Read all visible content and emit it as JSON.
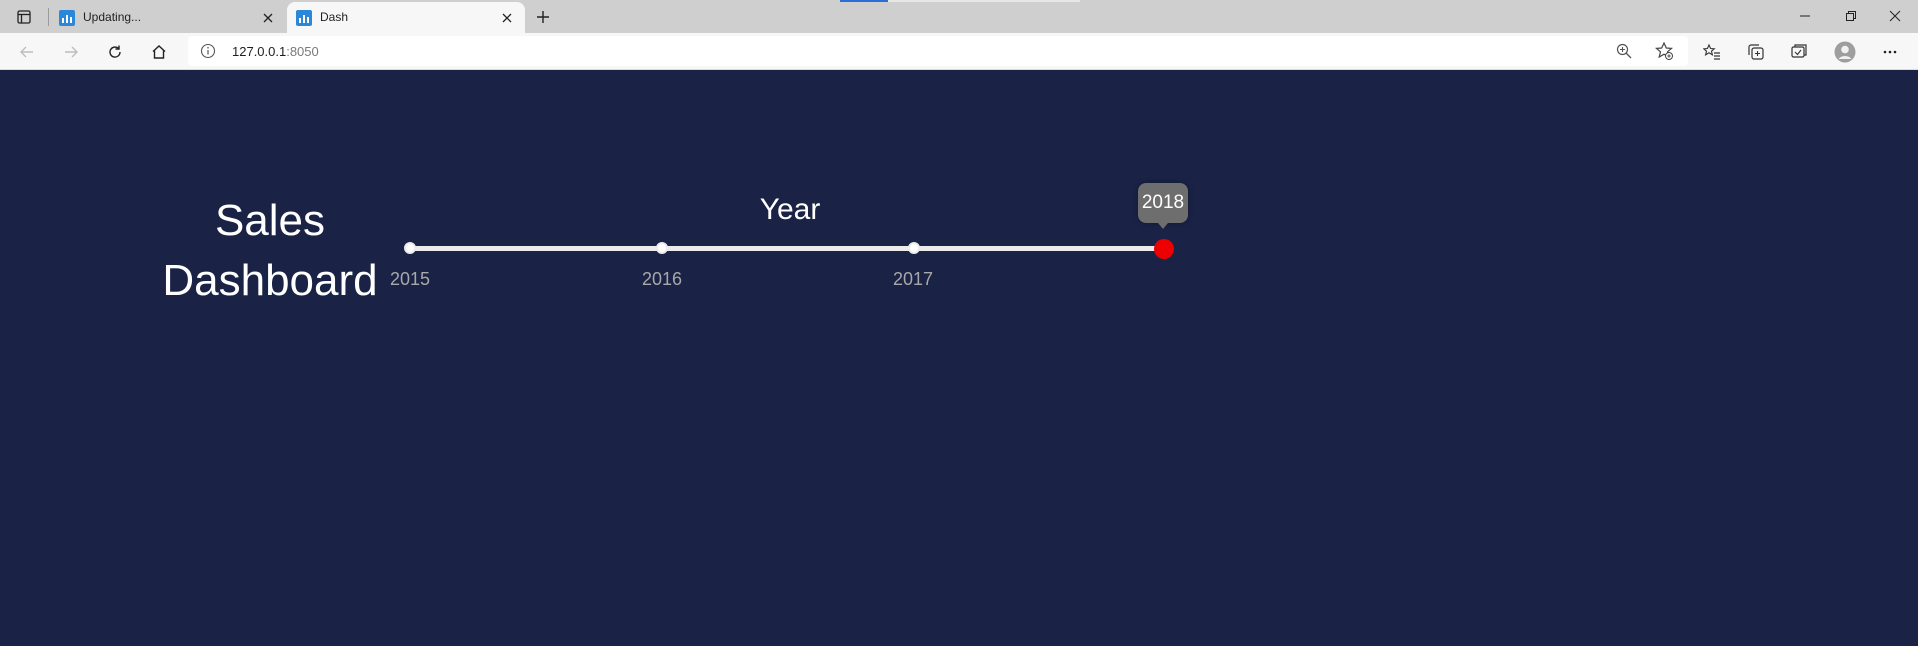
{
  "browser": {
    "tabs": [
      {
        "title": "Updating...",
        "active": false
      },
      {
        "title": "Dash",
        "active": true
      }
    ],
    "address": {
      "host": "127.0.0.1",
      "port": ":8050"
    },
    "accent": "#2b88d8"
  },
  "app": {
    "title_line1": "Sales",
    "title_line2": "Dashboard",
    "background": "#1a2346",
    "year_slider": {
      "label": "Year",
      "marks": [
        "2015",
        "2016",
        "2017",
        "2018"
      ],
      "min": 2015,
      "max": 2018,
      "selected": "2018",
      "handle_color": "#ee0000"
    }
  }
}
